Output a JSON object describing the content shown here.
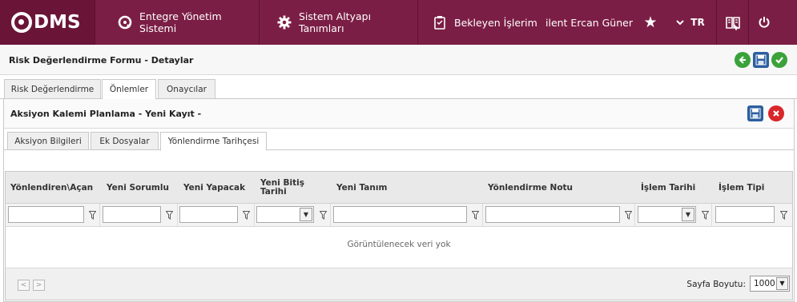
{
  "navbar": {
    "logo_text": "DMS",
    "items": [
      {
        "label": "Entegre Yönetim Sistemi",
        "icon": "q-logo-icon"
      },
      {
        "label": "Sistem Altyapı Tanımları",
        "icon": "gear-icon"
      },
      {
        "label": "Bekleyen İşlerim",
        "icon": "clipboard-icon"
      }
    ],
    "user": "ilent Ercan Güner",
    "favorites_icon": "star-icon",
    "lang_chevron_icon": "chevron-down-icon",
    "language": "TR",
    "help_icon": "book-icon",
    "power_icon": "power-icon",
    "colors": {
      "bar": "#7b1e45",
      "logo_bg": "#6a1538"
    }
  },
  "page": {
    "title": "Risk Değerlendirme Formu - Detaylar",
    "actions": [
      "back-icon",
      "save-icon",
      "confirm-icon"
    ]
  },
  "outer_tabs": [
    {
      "label": "Risk Değerlendirme",
      "active": false
    },
    {
      "label": "Önlemler",
      "active": true
    },
    {
      "label": "Onaycılar",
      "active": false
    }
  ],
  "panel": {
    "title": "Aksiyon Kalemi Planlama - Yeni Kayıt -",
    "actions": [
      "save-icon",
      "close-icon"
    ],
    "tabs": [
      {
        "label": "Aksiyon Bilgileri",
        "active": false
      },
      {
        "label": "Ek Dosyalar",
        "active": false
      },
      {
        "label": "Yönlendirme Tarihçesi",
        "active": true
      }
    ]
  },
  "grid": {
    "columns": [
      "Yönlendiren\\Açan",
      "Yeni Sorumlu",
      "Yeni Yapacak",
      "Yeni Bitiş Tarihi",
      "Yeni Tanım",
      "Yönlendirme Notu",
      "İşlem Tarihi",
      "İşlem Tipi"
    ],
    "empty_message": "Görüntülenecek veri yok",
    "page_size_label": "Sayfa Boyutu:",
    "page_size": "1000"
  }
}
